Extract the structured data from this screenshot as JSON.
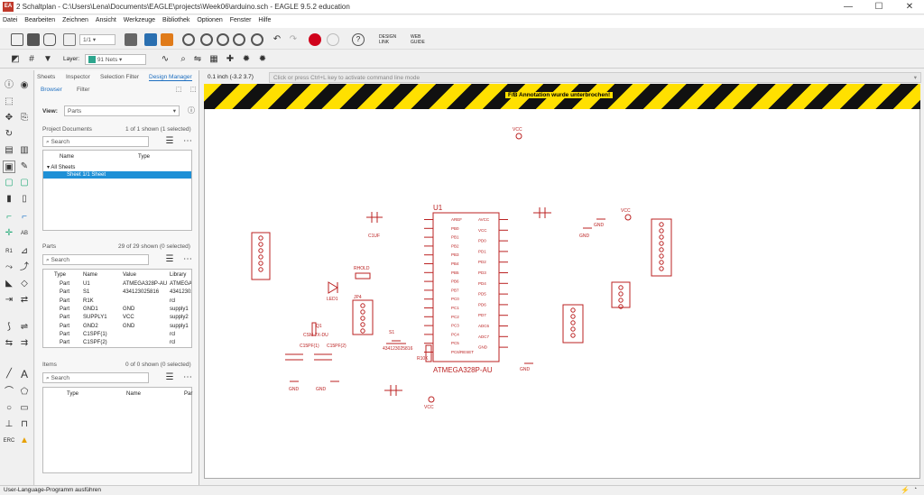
{
  "window": {
    "title": "2 Schaltplan - C:\\Users\\Lena\\Documents\\EAGLE\\projects\\Week06\\arduino.sch - EAGLE 9.5.2 education",
    "app_icon": "eagle-icon"
  },
  "menu": [
    "Datei",
    "Bearbeiten",
    "Zeichnen",
    "Ansicht",
    "Werkzeuge",
    "Bibliothek",
    "Optionen",
    "Fenster",
    "Hilfe"
  ],
  "toolbar": {
    "sheet_select": "1/1",
    "design_link": "DESIGN\nLINK",
    "web_guide": "WEB\nGUIDE"
  },
  "layerbar": {
    "layer_label": "Layer:",
    "layer_value": "91 Nets",
    "layer_color": "#2ca58d"
  },
  "panel": {
    "tabs": [
      "Sheets",
      "Inspector",
      "Selection Filter",
      "Design Manager"
    ],
    "subtabs": [
      "Browser",
      "Filter"
    ],
    "view_label": "View:",
    "view_value": "Parts",
    "project_docs": {
      "label": "Project Documents",
      "count": "1 of 1 shown (1 selected)",
      "search": "Search",
      "headers": [
        "Name",
        "Type"
      ],
      "root": "All Sheets",
      "selected": "Sheet 1/1  Sheet"
    },
    "parts": {
      "label": "Parts",
      "count": "29 of 29 shown (0 selected)",
      "search": "Search",
      "headers": [
        "Type",
        "Name",
        "Value",
        "Library"
      ],
      "rows": [
        [
          "Part",
          "U1",
          "ATMEGA328P-AU",
          "ATMEGA328"
        ],
        [
          "Part",
          "S1",
          "434123025816",
          "434123025"
        ],
        [
          "Part",
          "R1K",
          "",
          "rcl"
        ],
        [
          "Part",
          "GND1",
          "GND",
          "supply1"
        ],
        [
          "Part",
          "SUPPLY1",
          "VCC",
          "supply2"
        ],
        [
          "Part",
          "GND2",
          "GND",
          "supply1"
        ],
        [
          "Part",
          "C1SPF(1)",
          "",
          "rcl"
        ],
        [
          "Part",
          "C1SPF(2)",
          "",
          "rcl"
        ]
      ]
    },
    "items": {
      "label": "Items",
      "count": "0 of 0 shown (0 selected)",
      "search": "Search",
      "headers": [
        "Type",
        "Name",
        "Par"
      ]
    }
  },
  "canvas": {
    "coords": "0.1 inch (-3.2 3.7)",
    "command_placeholder": "Click or press Ctrl+L key to activate command line mode",
    "warning": "F/B Annotation wurde unterbrochen!",
    "labels": {
      "u1": "U1",
      "u1_value": "ATMEGA328P-AU",
      "vcc1": "VCC",
      "vcc2": "VCC",
      "vcc3": "VCC",
      "gnd1": "GND",
      "gnd2": "GND",
      "gnd3": "GND",
      "gnd4": "GND",
      "gnd5": "GND",
      "crystal": "CSM-7X-DU",
      "crystal_ref": "Q1",
      "led": "LED1",
      "rhold": "RHOLD",
      "jp": "JP4",
      "s1": "S1",
      "s1_val": "434123025816",
      "c1": "C15PF(1)",
      "c2": "C15PF(2)",
      "c10uf": "C1UF",
      "r10k": "R10K",
      "pins_left": [
        "AREF",
        "PB0",
        "PB1",
        "PB2",
        "PB3",
        "PB4",
        "PB5",
        "PB6",
        "PB7",
        "PC0",
        "PC1",
        "PC2",
        "PC3",
        "PC4",
        "PC5",
        "PC6/RESET"
      ],
      "pins_right": [
        "AVCC",
        "VCC",
        "PD0",
        "PD1",
        "PD2",
        "PD3",
        "PD4",
        "PD5",
        "PD6",
        "PD7",
        "ADC6",
        "ADC7",
        "GND"
      ]
    }
  },
  "status": {
    "text": "User-Language-Programm ausführen"
  }
}
